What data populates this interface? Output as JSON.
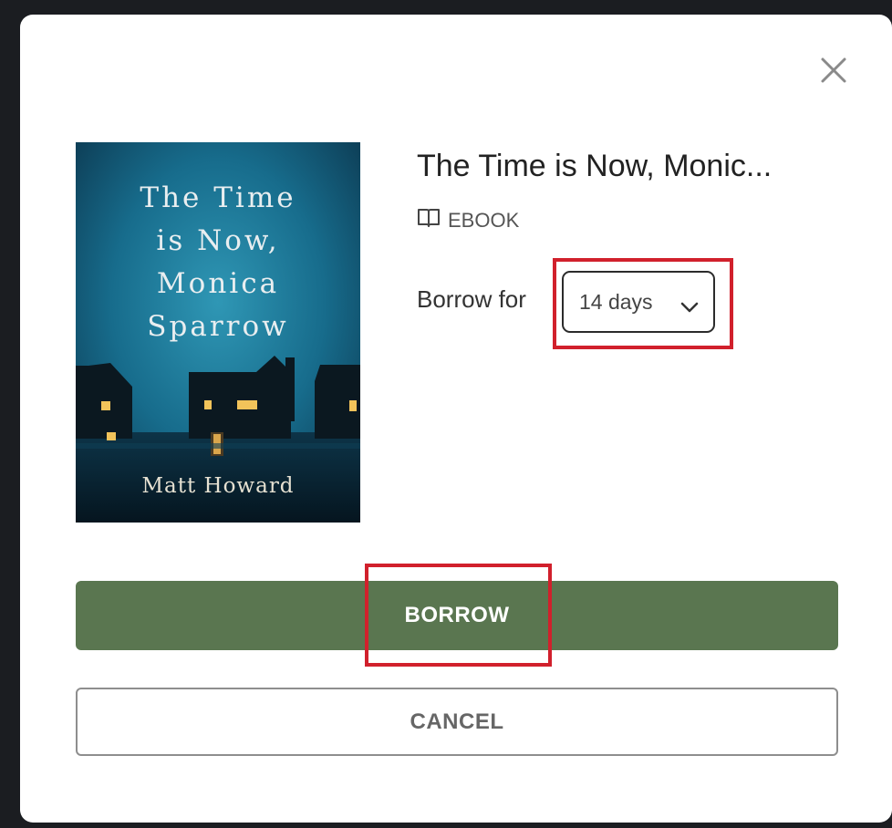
{
  "dialog": {
    "close_icon": "close-icon",
    "book": {
      "title": "The Time is Now, Monic...",
      "format": "EBOOK",
      "format_icon": "open-book-icon",
      "cover": {
        "title_lines": "The Time\nis Now,\nMonica\nSparrow",
        "author": "Matt Howard"
      }
    },
    "borrow_for": {
      "label": "Borrow for",
      "selected": "14 days"
    },
    "buttons": {
      "borrow": "BORROW",
      "cancel": "CANCEL"
    },
    "colors": {
      "borrow_button": "#5a7650",
      "highlight": "#d1202c"
    }
  }
}
